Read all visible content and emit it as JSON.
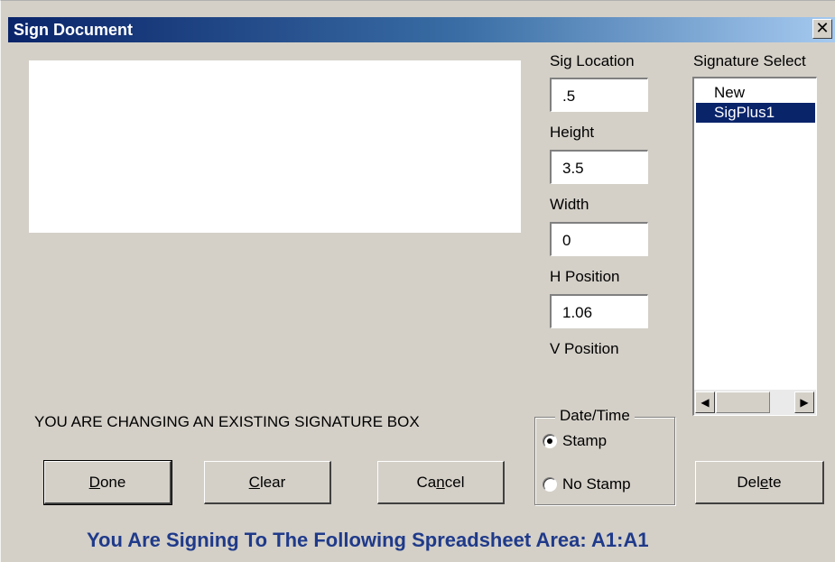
{
  "window": {
    "title": "Sign Document",
    "close_glyph": "✕"
  },
  "fields": {
    "sig_location": {
      "label": "Sig Location",
      "value": ".5"
    },
    "height": {
      "label": "Height",
      "value": "3.5"
    },
    "width": {
      "label": "Width",
      "value": "0"
    },
    "h_position": {
      "label": "H Position",
      "value": "1.06"
    },
    "v_position": {
      "label": "V Position"
    }
  },
  "signature_select": {
    "label": "Signature Select",
    "items": [
      "New",
      "SigPlus1"
    ],
    "selected": "SigPlus1"
  },
  "date_time": {
    "legend": "Date/Time",
    "options": [
      "Stamp",
      "No Stamp"
    ],
    "selected": "Stamp"
  },
  "message": "YOU ARE CHANGING AN EXISTING SIGNATURE BOX",
  "buttons": {
    "done": {
      "pre": "",
      "accel": "D",
      "post": "one"
    },
    "clear": {
      "pre": "",
      "accel": "C",
      "post": "lear"
    },
    "cancel": {
      "pre": "Ca",
      "accel": "n",
      "post": "cel"
    },
    "delete": {
      "pre": "Del",
      "accel": "e",
      "post": "te"
    }
  },
  "status": "You Are Signing To The Following Spreadsheet Area: A1:A1",
  "icons": {
    "close": "close-icon",
    "scroll_left": "arrow-left-icon",
    "scroll_right": "arrow-right-icon"
  },
  "colors": {
    "title_gradient_start": "#0a246a",
    "title_gradient_end": "#a6caf0",
    "selection": "#0a246a",
    "status_text": "#1f3a8a",
    "face": "#d4d0c8"
  }
}
